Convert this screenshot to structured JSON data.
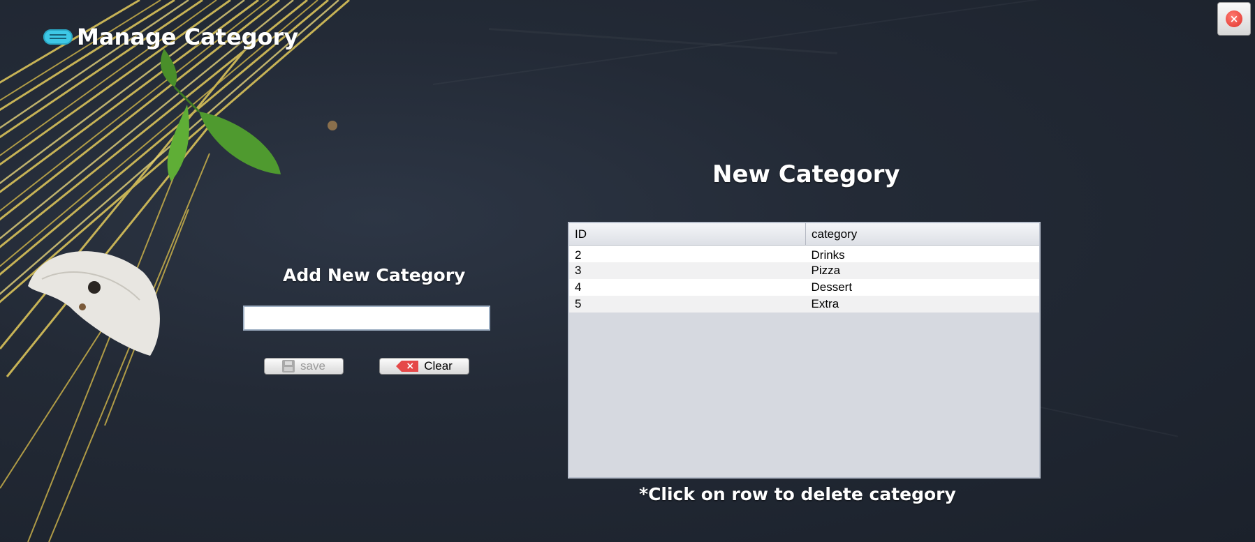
{
  "window": {
    "title": "Manage Category",
    "title_icon": "message-bubble-icon",
    "close_icon": "close-circle-icon"
  },
  "form": {
    "heading": "Add New Category",
    "input_value": "",
    "save_label": "save",
    "clear_label": "Clear",
    "save_icon": "floppy-disk-icon",
    "clear_icon": "eraser-icon"
  },
  "table_section": {
    "heading": "New Category",
    "columns": [
      "ID",
      "category"
    ],
    "rows": [
      {
        "id": "2",
        "category": "Drinks"
      },
      {
        "id": "3",
        "category": "Pizza"
      },
      {
        "id": "4",
        "category": "Dessert"
      },
      {
        "id": "5",
        "category": "Extra"
      }
    ],
    "hint": "*Click on row to delete category"
  },
  "colors": {
    "background": "#232a36",
    "text": "#ffffff",
    "table_body": "#d6d9e0",
    "accent_close": "#e0332c",
    "title_icon": "#3ec8e6"
  }
}
